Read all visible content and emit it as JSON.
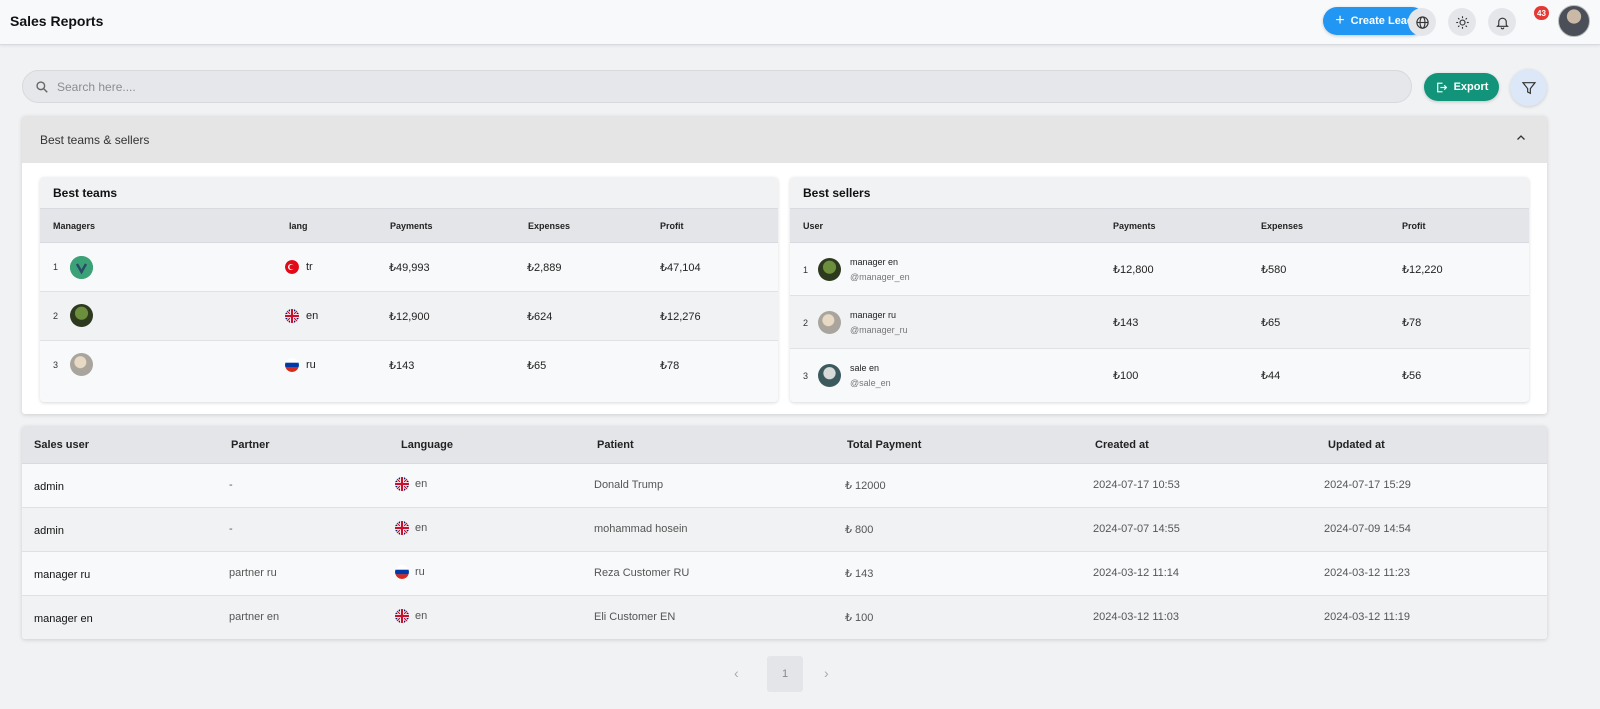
{
  "header": {
    "title": "Sales Reports",
    "create_lead_label": "Create Lead",
    "notification_count": "43",
    "icons": [
      "globe-icon",
      "brightness-icon",
      "bell-icon"
    ]
  },
  "search": {
    "placeholder": "Search here...."
  },
  "export_label": "Export",
  "accordion": {
    "title": "Best teams & sellers"
  },
  "best_teams": {
    "title": "Best teams",
    "columns": {
      "managers": "Managers",
      "lang": "lang",
      "payments": "Payments",
      "expenses": "Expenses",
      "profit": "Profit"
    },
    "rows": [
      {
        "rank": "1",
        "lang": "tr",
        "payments": "₺49,993",
        "expenses": "₺2,889",
        "profit": "₺47,104"
      },
      {
        "rank": "2",
        "lang": "en",
        "payments": "₺12,900",
        "expenses": "₺624",
        "profit": "₺12,276"
      },
      {
        "rank": "3",
        "lang": "ru",
        "payments": "₺143",
        "expenses": "₺65",
        "profit": "₺78"
      }
    ]
  },
  "best_sellers": {
    "title": "Best sellers",
    "columns": {
      "user": "User",
      "payments": "Payments",
      "expenses": "Expenses",
      "profit": "Profit"
    },
    "rows": [
      {
        "rank": "1",
        "name": "manager en",
        "handle": "@manager_en",
        "payments": "₺12,800",
        "expenses": "₺580",
        "profit": "₺12,220"
      },
      {
        "rank": "2",
        "name": "manager ru",
        "handle": "@manager_ru",
        "payments": "₺143",
        "expenses": "₺65",
        "profit": "₺78"
      },
      {
        "rank": "3",
        "name": "sale en",
        "handle": "@sale_en",
        "payments": "₺100",
        "expenses": "₺44",
        "profit": "₺56"
      }
    ]
  },
  "sales_table": {
    "columns": {
      "sales_user": "Sales user",
      "partner": "Partner",
      "language": "Language",
      "patient": "Patient",
      "total_payment": "Total Payment",
      "created_at": "Created at",
      "updated_at": "Updated at"
    },
    "rows": [
      {
        "sales_user": "admin",
        "partner": "-",
        "language": "en",
        "patient": "Donald Trump",
        "total_payment": "₺ 12000",
        "created_at": "2024-07-17 10:53",
        "updated_at": "2024-07-17 15:29"
      },
      {
        "sales_user": "admin",
        "partner": "-",
        "language": "en",
        "patient": "mohammad hosein",
        "total_payment": "₺ 800",
        "created_at": "2024-07-07 14:55",
        "updated_at": "2024-07-09 14:54"
      },
      {
        "sales_user": "manager ru",
        "partner": "partner ru",
        "language": "ru",
        "patient": "Reza Customer RU",
        "total_payment": "₺ 143",
        "created_at": "2024-03-12 11:14",
        "updated_at": "2024-03-12 11:23"
      },
      {
        "sales_user": "manager en",
        "partner": "partner en",
        "language": "en",
        "patient": "Eli Customer EN",
        "total_payment": "₺ 100",
        "created_at": "2024-03-12 11:03",
        "updated_at": "2024-03-12 11:19"
      }
    ]
  },
  "pagination": {
    "current": "1",
    "prev": "‹",
    "next": "›"
  },
  "colors": {
    "primary": "#2196f3",
    "export": "#11947a",
    "badge": "#e53935"
  }
}
